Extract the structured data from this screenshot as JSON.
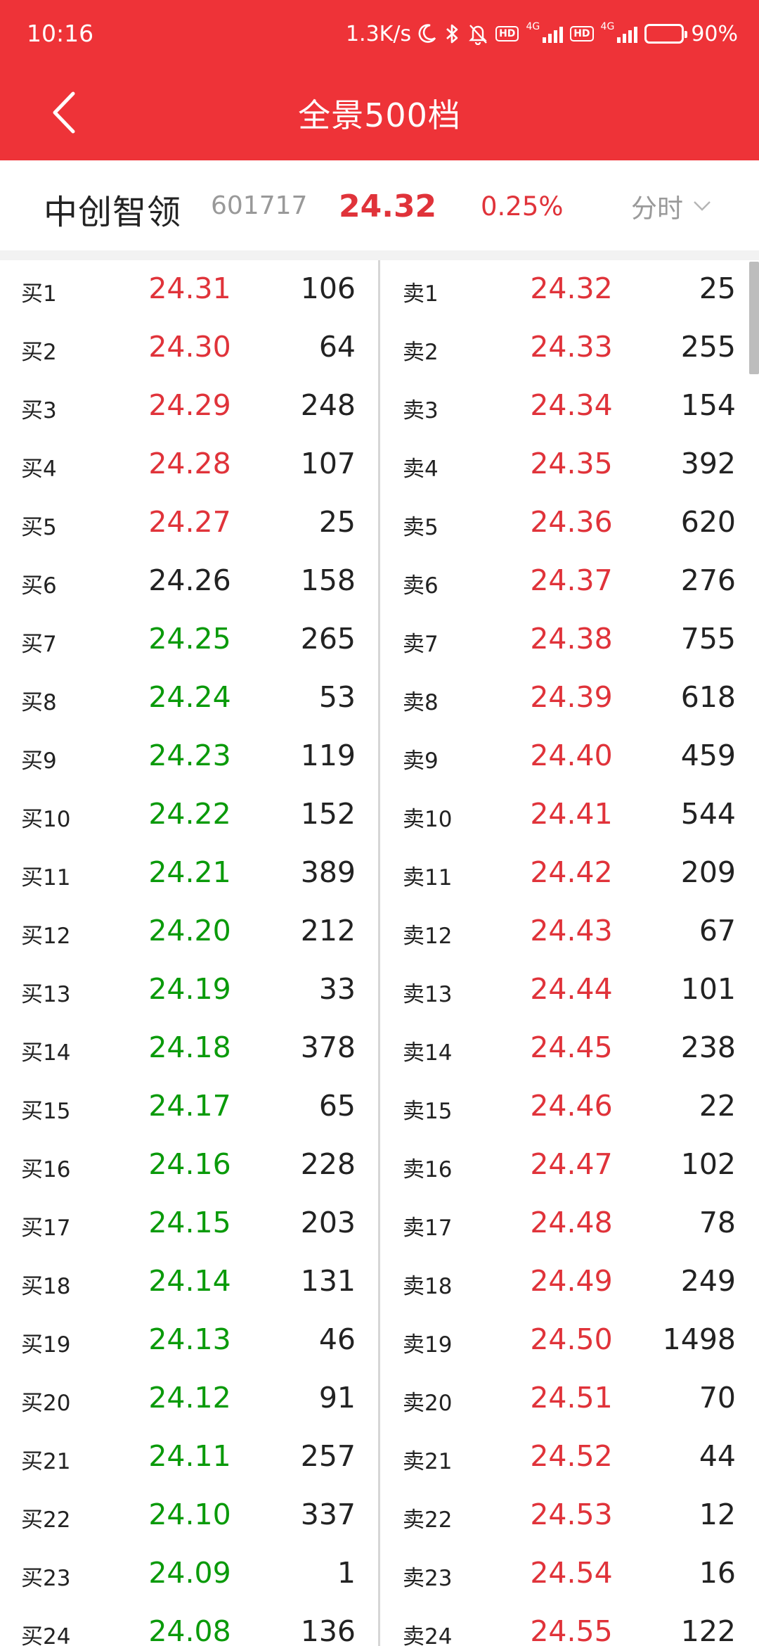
{
  "status_bar": {
    "time": "10:16",
    "net_speed": "1.3K/s",
    "hd1": "HD",
    "net1": "4G",
    "hd2": "HD",
    "net2": "4G",
    "battery": "90%",
    "battery_level": 0.9
  },
  "nav": {
    "title": "全景500档"
  },
  "stock": {
    "name": "中创智领",
    "code": "601717",
    "price": "24.32",
    "change": "0.25%",
    "period": "分时"
  },
  "colors": {
    "header_bg": "#ee3338",
    "up": "#e0333a",
    "down": "#0a9a0a",
    "flat": "#222222"
  },
  "bids": [
    {
      "label": "买1",
      "price": "24.31",
      "vol": "106",
      "trend": "up"
    },
    {
      "label": "买2",
      "price": "24.30",
      "vol": "64",
      "trend": "up"
    },
    {
      "label": "买3",
      "price": "24.29",
      "vol": "248",
      "trend": "up"
    },
    {
      "label": "买4",
      "price": "24.28",
      "vol": "107",
      "trend": "up"
    },
    {
      "label": "买5",
      "price": "24.27",
      "vol": "25",
      "trend": "up"
    },
    {
      "label": "买6",
      "price": "24.26",
      "vol": "158",
      "trend": "flat"
    },
    {
      "label": "买7",
      "price": "24.25",
      "vol": "265",
      "trend": "down"
    },
    {
      "label": "买8",
      "price": "24.24",
      "vol": "53",
      "trend": "down"
    },
    {
      "label": "买9",
      "price": "24.23",
      "vol": "119",
      "trend": "down"
    },
    {
      "label": "买10",
      "price": "24.22",
      "vol": "152",
      "trend": "down"
    },
    {
      "label": "买11",
      "price": "24.21",
      "vol": "389",
      "trend": "down"
    },
    {
      "label": "买12",
      "price": "24.20",
      "vol": "212",
      "trend": "down"
    },
    {
      "label": "买13",
      "price": "24.19",
      "vol": "33",
      "trend": "down"
    },
    {
      "label": "买14",
      "price": "24.18",
      "vol": "378",
      "trend": "down"
    },
    {
      "label": "买15",
      "price": "24.17",
      "vol": "65",
      "trend": "down"
    },
    {
      "label": "买16",
      "price": "24.16",
      "vol": "228",
      "trend": "down"
    },
    {
      "label": "买17",
      "price": "24.15",
      "vol": "203",
      "trend": "down"
    },
    {
      "label": "买18",
      "price": "24.14",
      "vol": "131",
      "trend": "down"
    },
    {
      "label": "买19",
      "price": "24.13",
      "vol": "46",
      "trend": "down"
    },
    {
      "label": "买20",
      "price": "24.12",
      "vol": "91",
      "trend": "down"
    },
    {
      "label": "买21",
      "price": "24.11",
      "vol": "257",
      "trend": "down"
    },
    {
      "label": "买22",
      "price": "24.10",
      "vol": "337",
      "trend": "down"
    },
    {
      "label": "买23",
      "price": "24.09",
      "vol": "1",
      "trend": "down"
    },
    {
      "label": "买24",
      "price": "24.08",
      "vol": "136",
      "trend": "down"
    }
  ],
  "asks": [
    {
      "label": "卖1",
      "price": "24.32",
      "vol": "25",
      "trend": "up"
    },
    {
      "label": "卖2",
      "price": "24.33",
      "vol": "255",
      "trend": "up"
    },
    {
      "label": "卖3",
      "price": "24.34",
      "vol": "154",
      "trend": "up"
    },
    {
      "label": "卖4",
      "price": "24.35",
      "vol": "392",
      "trend": "up"
    },
    {
      "label": "卖5",
      "price": "24.36",
      "vol": "620",
      "trend": "up"
    },
    {
      "label": "卖6",
      "price": "24.37",
      "vol": "276",
      "trend": "up"
    },
    {
      "label": "卖7",
      "price": "24.38",
      "vol": "755",
      "trend": "up"
    },
    {
      "label": "卖8",
      "price": "24.39",
      "vol": "618",
      "trend": "up"
    },
    {
      "label": "卖9",
      "price": "24.40",
      "vol": "459",
      "trend": "up"
    },
    {
      "label": "卖10",
      "price": "24.41",
      "vol": "544",
      "trend": "up"
    },
    {
      "label": "卖11",
      "price": "24.42",
      "vol": "209",
      "trend": "up"
    },
    {
      "label": "卖12",
      "price": "24.43",
      "vol": "67",
      "trend": "up"
    },
    {
      "label": "卖13",
      "price": "24.44",
      "vol": "101",
      "trend": "up"
    },
    {
      "label": "卖14",
      "price": "24.45",
      "vol": "238",
      "trend": "up"
    },
    {
      "label": "卖15",
      "price": "24.46",
      "vol": "22",
      "trend": "up"
    },
    {
      "label": "卖16",
      "price": "24.47",
      "vol": "102",
      "trend": "up"
    },
    {
      "label": "卖17",
      "price": "24.48",
      "vol": "78",
      "trend": "up"
    },
    {
      "label": "卖18",
      "price": "24.49",
      "vol": "249",
      "trend": "up"
    },
    {
      "label": "卖19",
      "price": "24.50",
      "vol": "1498",
      "trend": "up"
    },
    {
      "label": "卖20",
      "price": "24.51",
      "vol": "70",
      "trend": "up"
    },
    {
      "label": "卖21",
      "price": "24.52",
      "vol": "44",
      "trend": "up"
    },
    {
      "label": "卖22",
      "price": "24.53",
      "vol": "12",
      "trend": "up"
    },
    {
      "label": "卖23",
      "price": "24.54",
      "vol": "16",
      "trend": "up"
    },
    {
      "label": "卖24",
      "price": "24.55",
      "vol": "122",
      "trend": "up"
    }
  ]
}
